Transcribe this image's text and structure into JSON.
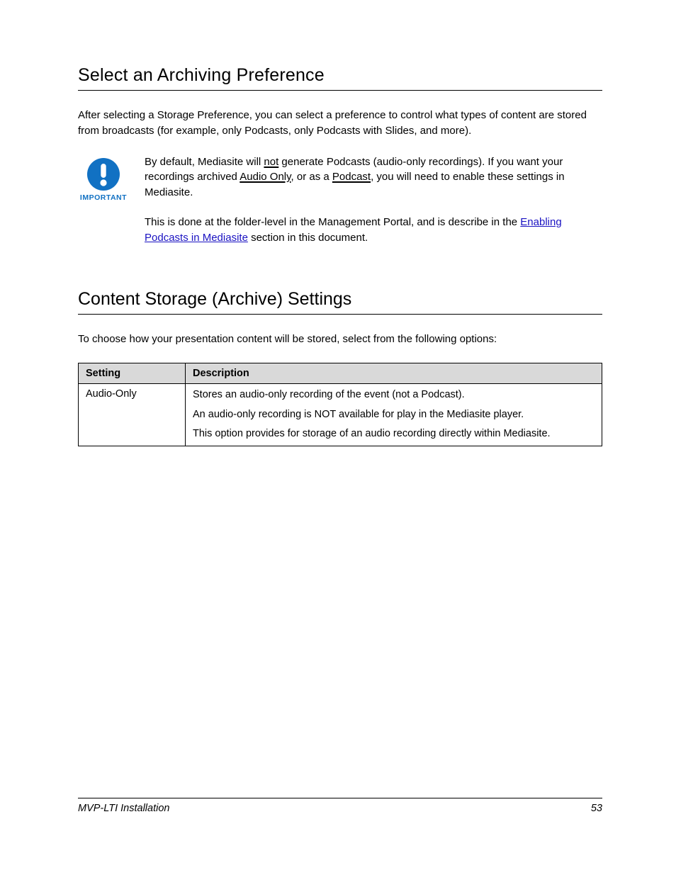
{
  "section1": {
    "heading": "Select an Archiving Preference",
    "lead": "After selecting a Storage Preference, you can select a preference to control what types of content are stored from broadcasts (for example, only Podcasts, only Podcasts with Slides, and more).",
    "important": {
      "icon_label": "IMPORTANT",
      "para1_prefix": "By default, Mediasite will ",
      "para1_u1": "not",
      "para1_mid": " generate Podcasts (audio-only recordings). If you want your recordings archived ",
      "para1_u2": "Audio Only",
      "para1_mid2": ", or as a ",
      "para1_u3": "Podcast",
      "para1_suffix": ", you will need to enable these settings in Mediasite.",
      "para2_prefix": "This is done at the folder-level in the Management Portal, and is describe in the ",
      "para2_link": "Enabling Podcasts in Mediasite",
      "para2_suffix": " section in this document."
    }
  },
  "section2": {
    "heading": "Content Storage (Archive) Settings",
    "lead": "To choose how your presentation content will be stored, select from the following options:",
    "table": {
      "headers": {
        "col1": "Setting",
        "col2": "Description"
      },
      "row": {
        "setting": "Audio-Only",
        "desc": [
          "Stores an audio-only recording of the event (not a Podcast).",
          "An audio-only recording is NOT available for play in the Mediasite player.",
          "This option provides for storage of an audio recording directly within Mediasite."
        ]
      }
    }
  },
  "footer": {
    "left": "MVP-LTI Installation",
    "right": "53"
  }
}
